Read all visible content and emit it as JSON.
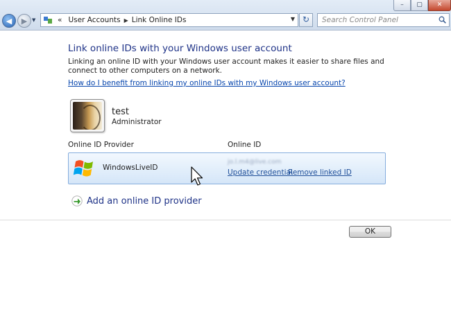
{
  "window": {
    "controls": [
      "–",
      "▢",
      "✕"
    ]
  },
  "nav": {
    "back_glyph": "◀",
    "forward_glyph": "▶",
    "menu_glyph": "▼"
  },
  "address": {
    "prefix": "«",
    "crumbs": [
      "User Accounts",
      "Link Online IDs"
    ],
    "separator": "▶",
    "dropdown_glyph": "▼"
  },
  "refresh": {
    "glyph": "↻"
  },
  "search": {
    "placeholder": "Search Control Panel"
  },
  "page": {
    "heading": "Link online IDs with your Windows user account",
    "intro": "Linking an online ID with your Windows user account makes it easier to share files and connect to other computers on a network.",
    "help_link": "How do I benefit from linking my online IDs with my Windows user account?"
  },
  "user": {
    "name": "test",
    "role": "Administrator"
  },
  "table": {
    "col_provider": "Online ID Provider",
    "col_online_id": "Online ID",
    "row": {
      "provider": "WindowsLiveID",
      "online_id": "jo.l.m4@live.com",
      "update_link": "Update credential",
      "remove_link": "Remove linked ID"
    }
  },
  "actions": {
    "add_provider": "Add an online ID provider",
    "ok": "OK"
  },
  "colors": {
    "heading": "#1e3287",
    "link": "#0645ad",
    "row_border": "#84acdd"
  }
}
